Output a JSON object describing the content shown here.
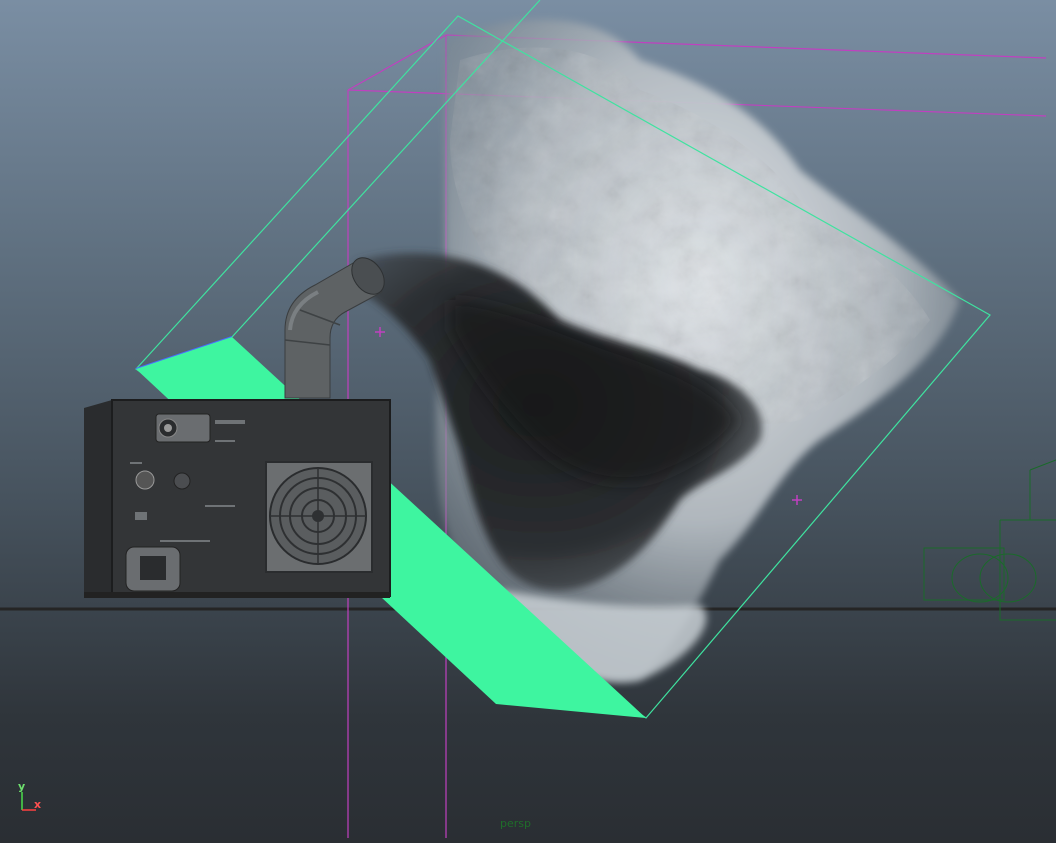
{
  "viewport": {
    "camera_name": "persp",
    "axis_labels": {
      "y": "y",
      "x": "x"
    }
  },
  "colors": {
    "bbox_green": "#3fe3a0",
    "locator_magenta": "#c040c0",
    "emitter_plane": "#3ef5a0",
    "ground_line": "#2a2a2a"
  },
  "objects": [
    "fog-machine",
    "smoke-fluid-volume",
    "emitter-plane",
    "fluid-container-bbox",
    "locator",
    "pipe"
  ]
}
